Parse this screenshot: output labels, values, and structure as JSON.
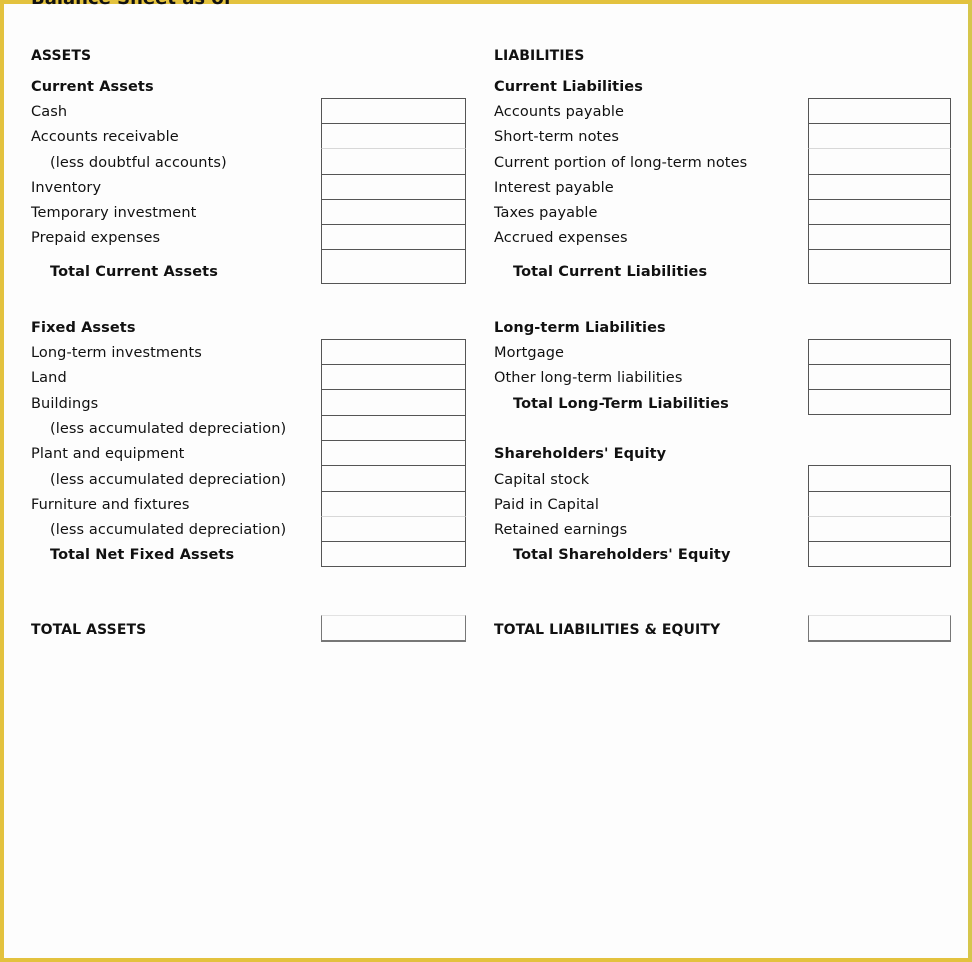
{
  "document": {
    "title": "Balance Sheet as of",
    "accent_border_color": "#e3c23e"
  },
  "assets": {
    "heading": "ASSETS",
    "current": {
      "heading": "Current Assets",
      "items": [
        {
          "label": "Cash",
          "value": ""
        },
        {
          "label": "Accounts receivable",
          "value": ""
        },
        {
          "label": "(less doubtful accounts)",
          "value": ""
        },
        {
          "label": "Inventory",
          "value": ""
        },
        {
          "label": "Temporary investment",
          "value": ""
        },
        {
          "label": "Prepaid expenses",
          "value": ""
        }
      ],
      "total_label": "Total Current Assets",
      "total_value": ""
    },
    "fixed": {
      "heading": "Fixed Assets",
      "items": [
        {
          "label": "Long-term investments",
          "value": ""
        },
        {
          "label": "Land",
          "value": ""
        },
        {
          "label": "Buildings",
          "value": ""
        },
        {
          "label": "(less accumulated depreciation)",
          "value": ""
        },
        {
          "label": "Plant and equipment",
          "value": ""
        },
        {
          "label": "(less accumulated depreciation)",
          "value": ""
        },
        {
          "label": "Furniture and fixtures",
          "value": ""
        },
        {
          "label": "(less accumulated depreciation)",
          "value": ""
        }
      ],
      "total_label": "Total Net Fixed Assets",
      "total_value": ""
    },
    "grand_total_label": "TOTAL ASSETS",
    "grand_total_value": ""
  },
  "liabilities": {
    "heading": "LIABILITIES",
    "current": {
      "heading": "Current Liabilities",
      "items": [
        {
          "label": "Accounts payable",
          "value": ""
        },
        {
          "label": "Short-term notes",
          "value": ""
        },
        {
          "label": "Current portion of long-term notes",
          "value": ""
        },
        {
          "label": "Interest payable",
          "value": ""
        },
        {
          "label": "Taxes payable",
          "value": ""
        },
        {
          "label": "Accrued expenses",
          "value": ""
        }
      ],
      "total_label": "Total Current Liabilities",
      "total_value": ""
    },
    "long_term": {
      "heading": "Long-term Liabilities",
      "items": [
        {
          "label": "Mortgage",
          "value": ""
        },
        {
          "label": "Other long-term liabilities",
          "value": ""
        }
      ],
      "total_label": "Total Long-Term Liabilities",
      "total_value": ""
    },
    "equity": {
      "heading": "Shareholders' Equity",
      "items": [
        {
          "label": "Capital stock",
          "value": ""
        },
        {
          "label": "Paid in Capital",
          "value": ""
        },
        {
          "label": "Retained earnings",
          "value": ""
        }
      ],
      "total_label": "Total Shareholders' Equity",
      "total_value": ""
    },
    "grand_total_label": "TOTAL LIABILITIES & EQUITY",
    "grand_total_value": ""
  }
}
